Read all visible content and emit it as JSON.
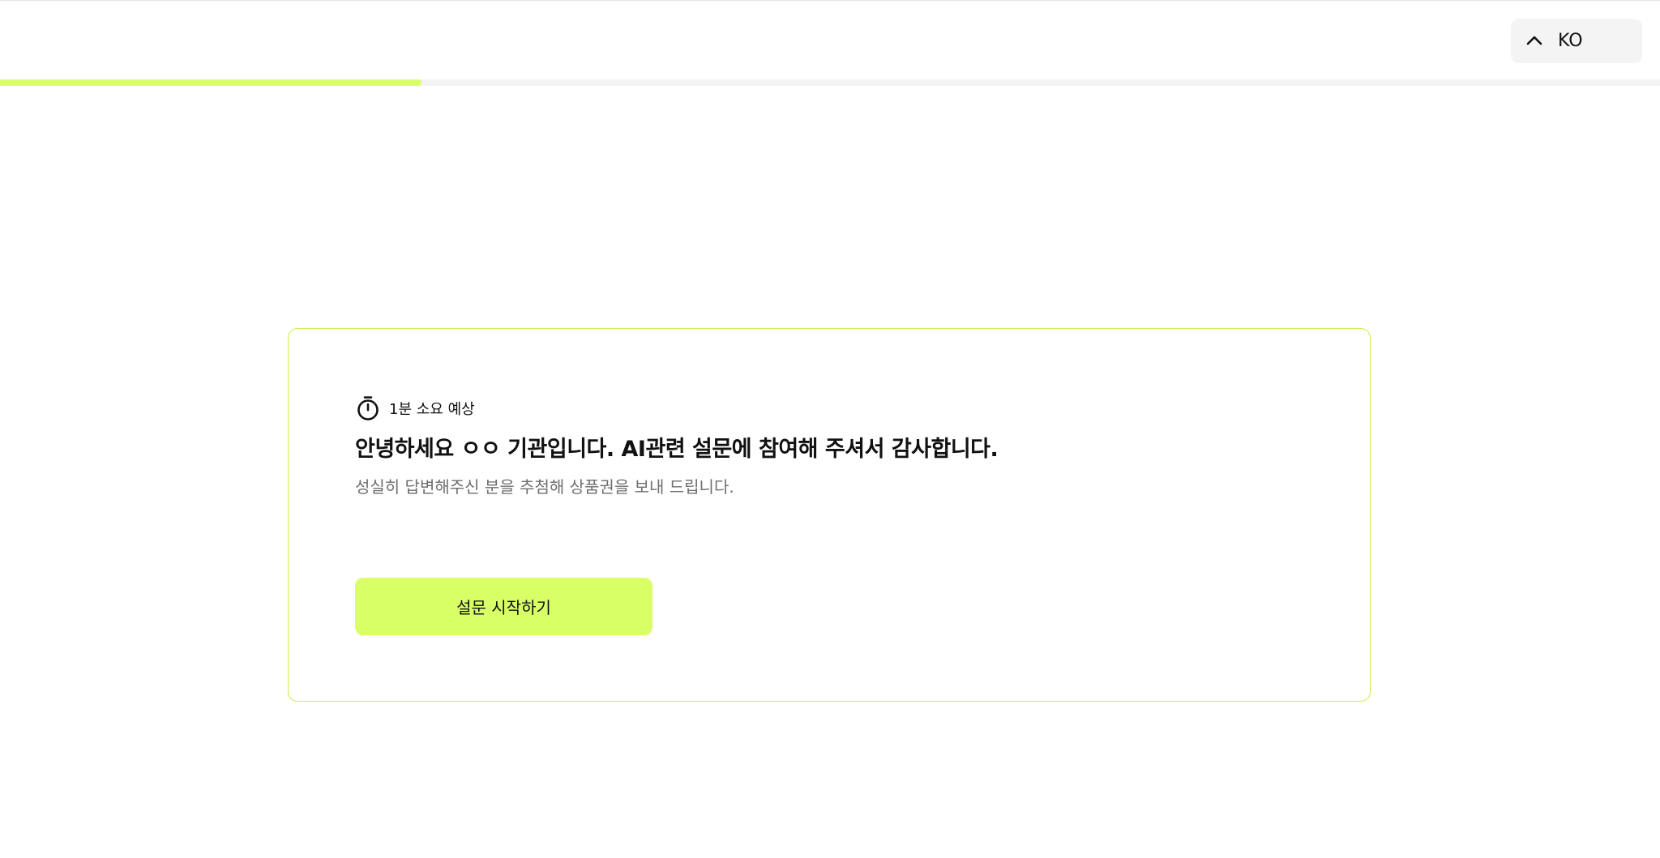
{
  "header": {
    "language": {
      "label": "KO",
      "icon": "chevron-up-icon"
    }
  },
  "progress": {
    "fraction": 0.254,
    "color": "#d8ff66"
  },
  "intro_card": {
    "duration": {
      "icon": "stopwatch-icon",
      "text": "1분 소요 예상"
    },
    "title": "안녕하세요 ㅇㅇ 기관입니다. AI관련 설문에 참여해 주셔서 감사합니다.",
    "description": "성실히 답변해주신 분을 추첨해 상품권을 보내 드립니다.",
    "start_button_label": "설문 시작하기"
  },
  "colors": {
    "accent": "#d8ff66",
    "card_border": "#c9ef4d",
    "muted_text": "#6e6e6e"
  }
}
